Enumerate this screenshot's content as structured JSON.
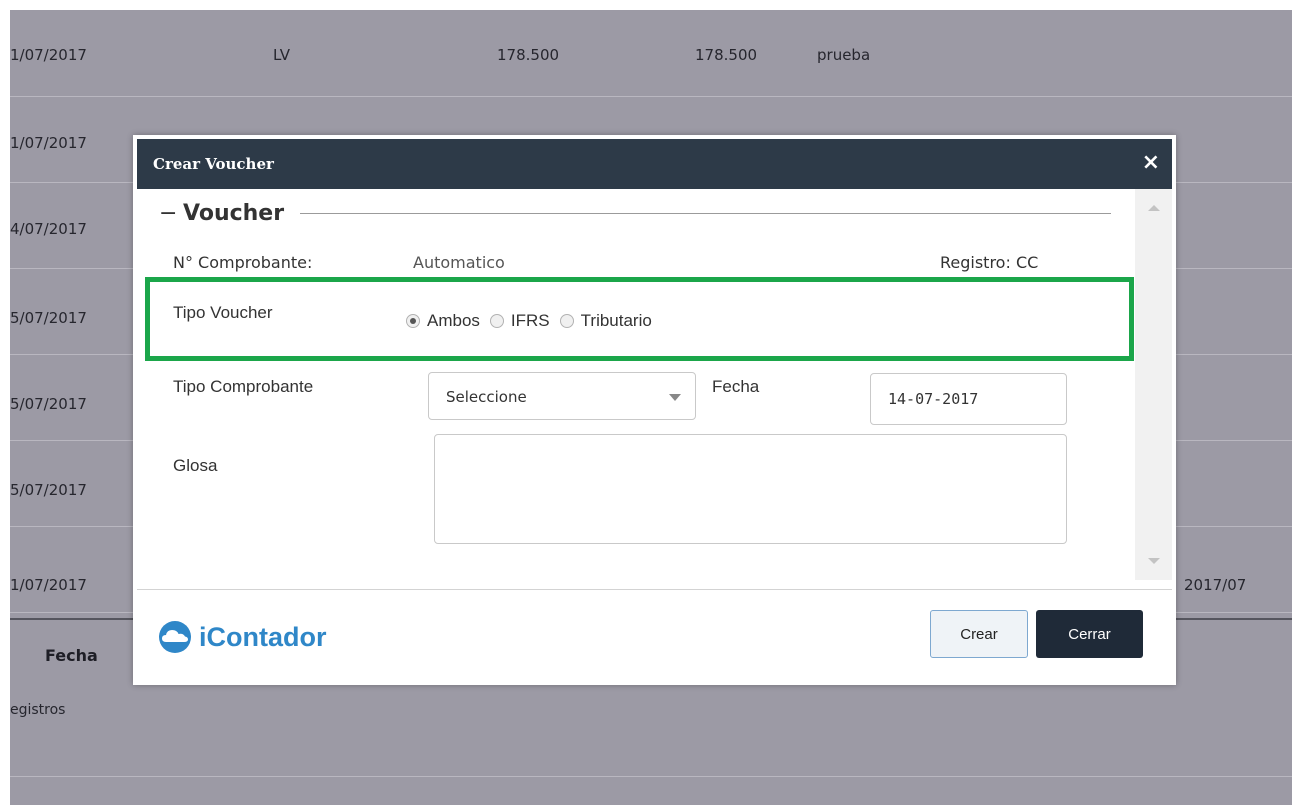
{
  "background_table": {
    "rows": [
      {
        "fecha": "1/07/2017",
        "tipo": "LV",
        "debe": "178.500",
        "haber": "178.500",
        "glosa": "prueba"
      },
      {
        "fecha": "1/07/2017"
      },
      {
        "fecha": "4/07/2017"
      },
      {
        "fecha": "5/07/2017"
      },
      {
        "fecha": "5/07/2017"
      },
      {
        "fecha": "5/07/2017"
      },
      {
        "fecha": "1/07/2017",
        "periodo": "2017/07"
      }
    ],
    "footer_header": "Fecha",
    "registros_text": "egistros"
  },
  "modal": {
    "title": "Crear Voucher",
    "close_icon": "×",
    "legend": "Voucher",
    "legend_toggle": "−",
    "comprobante_label": "N° Comprobante:",
    "comprobante_value": "Automatico",
    "registro_label": "Registro: CC",
    "tipo_voucher_label": "Tipo Voucher",
    "tipo_voucher_options": [
      "Ambos",
      "IFRS",
      "Tributario"
    ],
    "tipo_voucher_selected": "Ambos",
    "tipo_comprobante_label": "Tipo Comprobante",
    "tipo_comprobante_value": "Seleccione",
    "fecha_label": "Fecha",
    "fecha_value": "14-07-2017",
    "glosa_label": "Glosa",
    "glosa_value": "",
    "logo_text": "iContador",
    "crear_label": "Crear",
    "cerrar_label": "Cerrar"
  },
  "colors": {
    "header_bg": "#2d3a48",
    "highlight": "#1ba64a",
    "brand": "#2f87c8",
    "overlay_bg": "#9c9aa5"
  }
}
